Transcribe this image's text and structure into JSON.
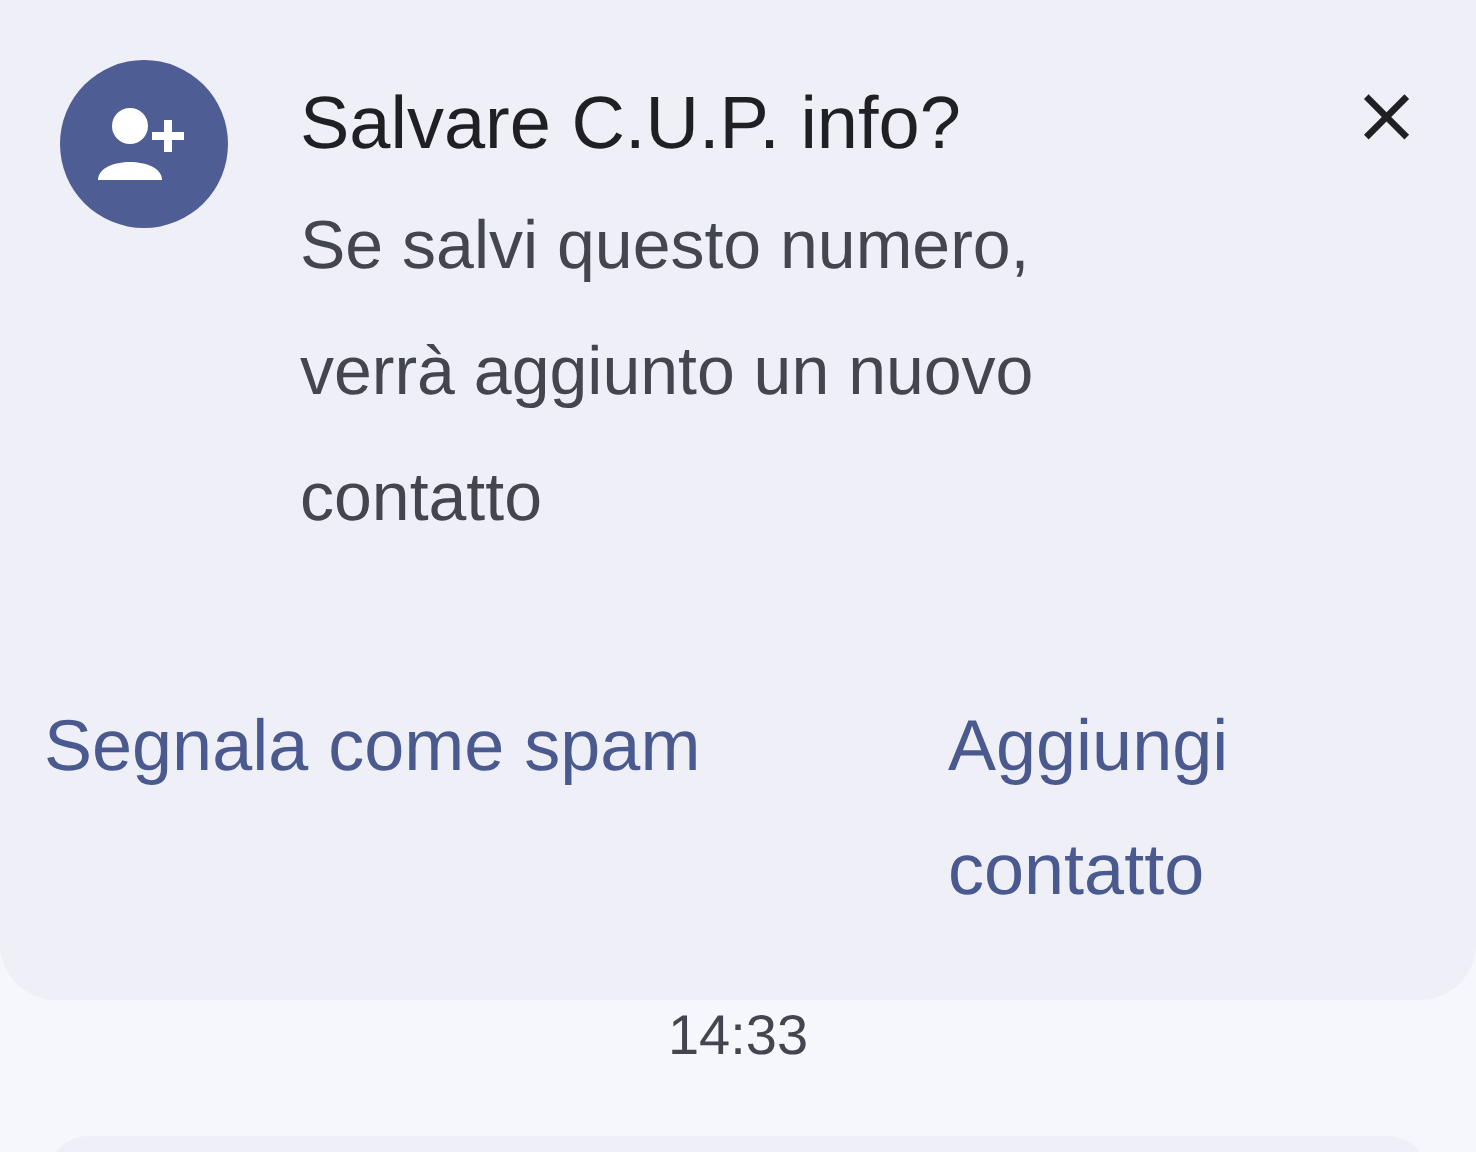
{
  "dialog": {
    "title": "Salvare C.U.P. info?",
    "close": "×",
    "message": "Se salvi questo numero, verrà aggiunto un nuovo contatto",
    "actions": [
      {
        "label": "Segnala come spam"
      },
      {
        "label": "Aggiungi contatto"
      }
    ]
  },
  "timestamp": "14:33"
}
